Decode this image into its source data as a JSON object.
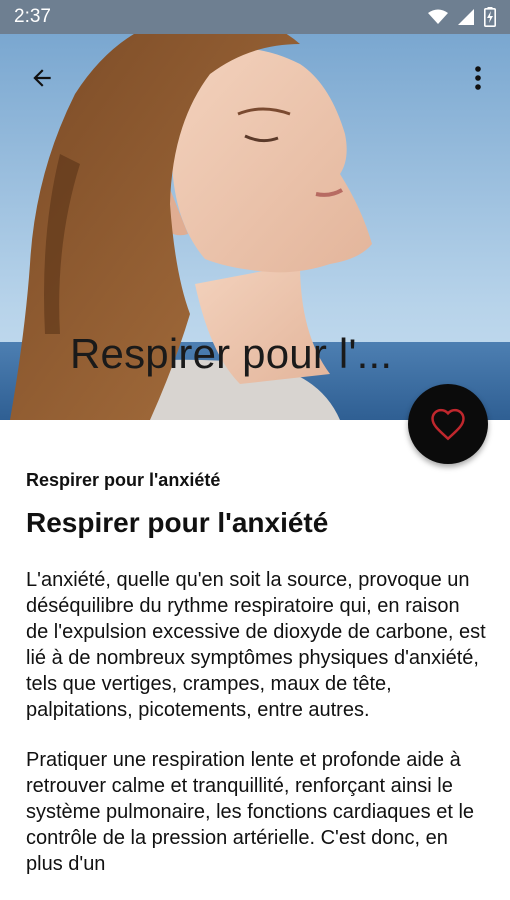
{
  "status": {
    "time": "2:37",
    "icons": [
      "wifi-icon",
      "signal-icon",
      "battery-icon"
    ]
  },
  "toolbar": {
    "back_icon": "arrow-back-icon",
    "more_icon": "more-vert-icon"
  },
  "hero": {
    "title": "Respirer pour l'..."
  },
  "fab": {
    "icon": "heart-outline-icon",
    "icon_color": "#c0272d"
  },
  "article": {
    "subtitle": "Respirer pour l'anxiété",
    "heading": "Respirer pour l'anxiété",
    "paragraphs": [
      "L'anxiété, quelle qu'en soit la source, provoque un déséquilibre du rythme respiratoire qui, en raison de l'expulsion excessive de dioxyde de carbone, est lié à de nombreux symptômes physiques d'anxiété, tels que vertiges, crampes, maux de tête, palpitations, picotements, entre autres.",
      "Pratiquer une respiration lente et profonde aide à retrouver calme et tranquillité, renforçant ainsi le système pulmonaire, les fonctions cardiaques et le contrôle de la pression artérielle. C'est donc, en plus d'un"
    ]
  },
  "colors": {
    "status_bar": "#6e7f91",
    "fab_background": "#0b0b0b",
    "sky": "#9fc1dd"
  }
}
